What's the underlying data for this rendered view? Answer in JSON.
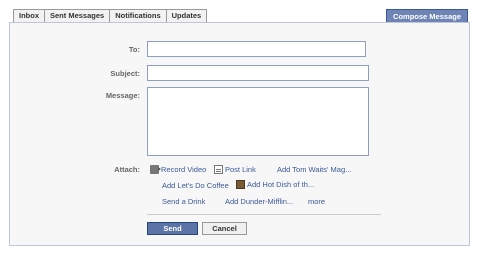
{
  "tabs": [
    "Inbox",
    "Sent Messages",
    "Notifications",
    "Updates"
  ],
  "compose_label": "Compose Message",
  "form": {
    "to_label": "To:",
    "subject_label": "Subject:",
    "message_label": "Message:",
    "attach_label": "Attach:"
  },
  "attach": {
    "record_video": "Record Video",
    "post_link": "Post Link",
    "tom_waits": "Add Tom Waits' Mag...",
    "lets_do_coffee": "Add Let's Do Coffee",
    "hot_dish": "Add Hot Dish of th...",
    "send_a_drink": "Send a Drink",
    "dunder_mifflin": "Add Dunder-Mifflin...",
    "more": "more"
  },
  "buttons": {
    "send": "Send",
    "cancel": "Cancel"
  }
}
